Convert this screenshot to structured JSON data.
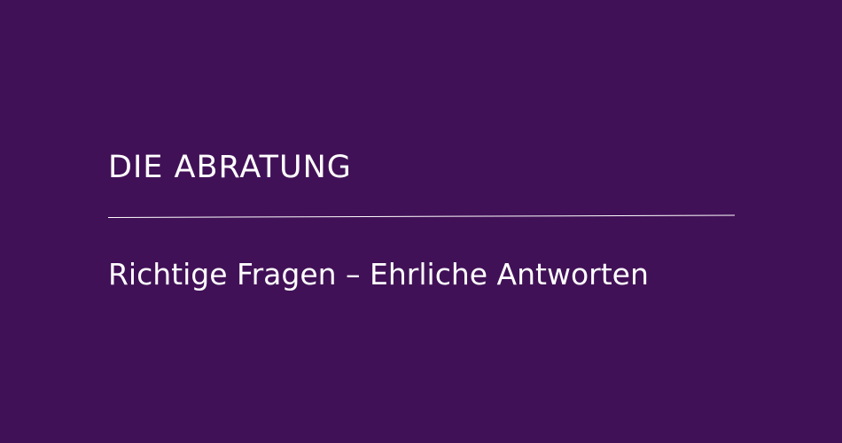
{
  "banner": {
    "title": "DIE ABRATUNG",
    "subtitle": "Richtige Fragen – Ehrliche Antworten",
    "background_color": "#411157",
    "text_color": "#ffffff"
  }
}
